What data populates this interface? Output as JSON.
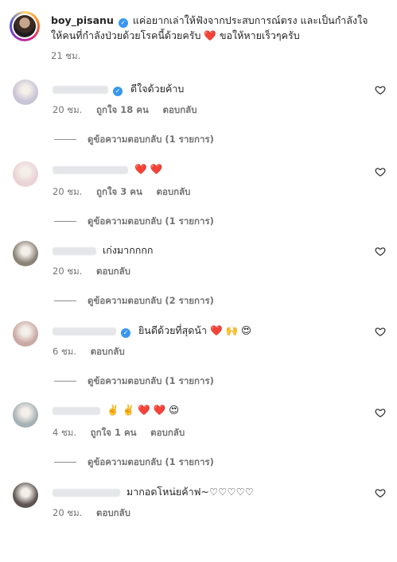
{
  "caption": {
    "username": "boy_pisanu",
    "text": "แค่อยากเล่าให้ฟังจากประสบการณ์ตรง และเป็นกำลังใจให้คนที่กำลังป่วยด้วยโรคนี้ด้วยครับ",
    "emoji": "❤️",
    "text_end": "ขอให้หายเร็วๆครับ",
    "time": "21 ชม."
  },
  "comments": [
    {
      "text": "ดีใจด้วยค้าบ",
      "verified": true,
      "time": "20 ชม.",
      "likes": "ถูกใจ 18 คน",
      "reply": "ตอบกลับ",
      "view_replies": "ดูข้อความตอบกลับ (1 รายการ)",
      "avatar_color": "#c9c3d6"
    },
    {
      "text": "❤️ ❤️",
      "verified": false,
      "time": "20 ชม.",
      "likes": "ถูกใจ 3 คน",
      "reply": "ตอบกลับ",
      "view_replies": "ดูข้อความตอบกลับ (1 รายการ)",
      "avatar_color": "#ead2d6"
    },
    {
      "text": "เก่งมากกกก",
      "verified": false,
      "time": "20 ชม.",
      "likes": "",
      "reply": "ตอบกลับ",
      "view_replies": "ดูข้อความตอบกลับ (2 รายการ)",
      "avatar_color": "#8a8378"
    },
    {
      "text": "ยินดีด้วยที่สุดน้า ❤️ 🙌 😍",
      "verified": true,
      "time": "6 ชม.",
      "likes": "",
      "reply": "ตอบกลับ",
      "view_replies": "ดูข้อความตอบกลับ (1 รายการ)",
      "avatar_color": "#c9a9a4"
    },
    {
      "text": "✌️ ✌️ ❤️ ❤️ 😍",
      "verified": false,
      "time": "4 ชม.",
      "likes": "ถูกใจ 1 คน",
      "reply": "ตอบกลับ",
      "view_replies": "ดูข้อความตอบกลับ (1 รายการ)",
      "avatar_color": "#a6b1b5"
    },
    {
      "text": "มากอดโหน่ยค้าฟ~♡♡♡♡♡",
      "verified": false,
      "time": "20 ชม.",
      "likes": "",
      "reply": "ตอบกลับ",
      "view_replies": "",
      "avatar_color": "#5e5553"
    }
  ],
  "icons": {
    "like": "heart-outline-icon",
    "verified": "verified-badge-icon"
  },
  "colors": {
    "verified": "#3897f0",
    "meta": "#737373",
    "heart": "#e2214c"
  }
}
